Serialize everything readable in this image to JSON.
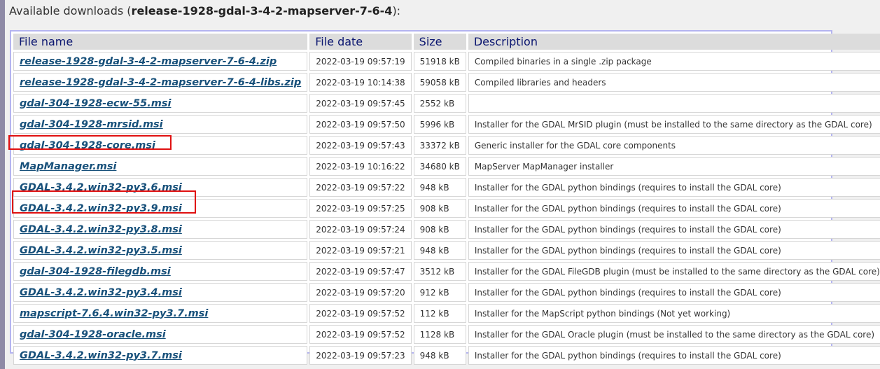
{
  "heading": {
    "prefix": "Available downloads (",
    "release": "release-1928-gdal-3-4-2-mapserver-7-6-4",
    "suffix": "):"
  },
  "table": {
    "columns": [
      "File name",
      "File date",
      "Size",
      "Description"
    ],
    "rows": [
      {
        "name": "release-1928-gdal-3-4-2-mapserver-7-6-4.zip",
        "date": "2022-03-19 09:57:19",
        "size": "51918 kB",
        "desc": "Compiled binaries in a single .zip package"
      },
      {
        "name": "release-1928-gdal-3-4-2-mapserver-7-6-4-libs.zip",
        "date": "2022-03-19 10:14:38",
        "size": "59058 kB",
        "desc": "Compiled libraries and headers"
      },
      {
        "name": "gdal-304-1928-ecw-55.msi",
        "date": "2022-03-19 09:57:45",
        "size": "2552 kB",
        "desc": ""
      },
      {
        "name": "gdal-304-1928-mrsid.msi",
        "date": "2022-03-19 09:57:50",
        "size": "5996 kB",
        "desc": "Installer for the GDAL MrSID plugin (must be installed to the same directory as the GDAL core)"
      },
      {
        "name": "gdal-304-1928-core.msi",
        "date": "2022-03-19 09:57:43",
        "size": "33372 kB",
        "desc": "Generic installer for the GDAL core components"
      },
      {
        "name": "MapManager.msi",
        "date": "2022-03-19 10:16:22",
        "size": "34680 kB",
        "desc": "MapServer MapManager installer"
      },
      {
        "name": "GDAL-3.4.2.win32-py3.6.msi",
        "date": "2022-03-19 09:57:22",
        "size": "948 kB",
        "desc": "Installer for the GDAL python bindings (requires to install the GDAL core)"
      },
      {
        "name": "GDAL-3.4.2.win32-py3.9.msi",
        "date": "2022-03-19 09:57:25",
        "size": "908 kB",
        "desc": "Installer for the GDAL python bindings (requires to install the GDAL core)"
      },
      {
        "name": "GDAL-3.4.2.win32-py3.8.msi",
        "date": "2022-03-19 09:57:24",
        "size": "908 kB",
        "desc": "Installer for the GDAL python bindings (requires to install the GDAL core)"
      },
      {
        "name": "GDAL-3.4.2.win32-py3.5.msi",
        "date": "2022-03-19 09:57:21",
        "size": "948 kB",
        "desc": "Installer for the GDAL python bindings (requires to install the GDAL core)"
      },
      {
        "name": "gdal-304-1928-filegdb.msi",
        "date": "2022-03-19 09:57:47",
        "size": "3512 kB",
        "desc": "Installer for the GDAL FileGDB plugin (must be installed to the same directory as the GDAL core)"
      },
      {
        "name": "GDAL-3.4.2.win32-py3.4.msi",
        "date": "2022-03-19 09:57:20",
        "size": "912 kB",
        "desc": "Installer for the GDAL python bindings (requires to install the GDAL core)"
      },
      {
        "name": "mapscript-7.6.4.win32-py3.7.msi",
        "date": "2022-03-19 09:57:52",
        "size": "112 kB",
        "desc": "Installer for the MapScript python bindings (Not yet working)"
      },
      {
        "name": "gdal-304-1928-oracle.msi",
        "date": "2022-03-19 09:57:52",
        "size": "1128 kB",
        "desc": "Installer for the GDAL Oracle plugin (must be installed to the same directory as the GDAL core)"
      },
      {
        "name": "GDAL-3.4.2.win32-py3.7.msi",
        "date": "2022-03-19 09:57:23",
        "size": "948 kB",
        "desc": "Installer for the GDAL python bindings (requires to install the GDAL core)"
      }
    ]
  },
  "highlight_color": "#e01010",
  "link_color": "#17507a",
  "header_text_color": "#0b1670"
}
